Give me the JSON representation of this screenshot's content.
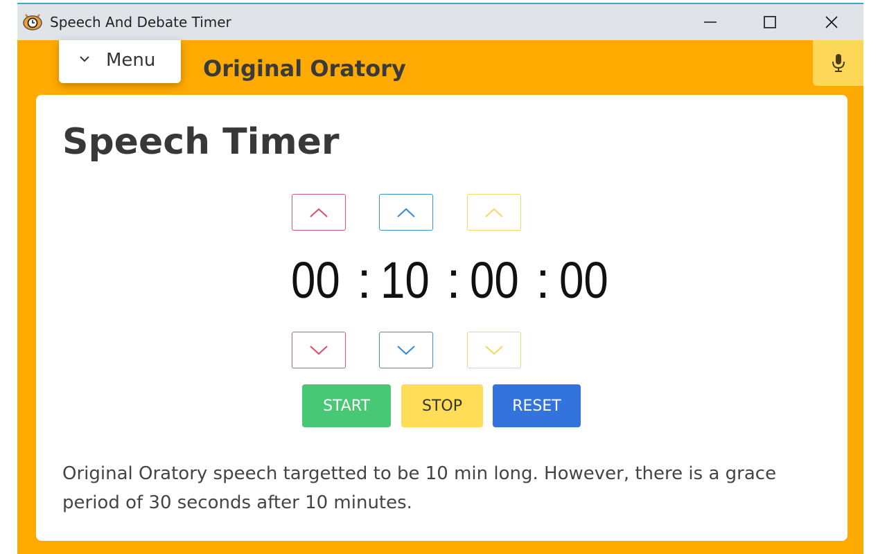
{
  "window": {
    "title": "Speech And Debate Timer",
    "icon": "timer-eye-app-icon",
    "controls": [
      "minimize-icon",
      "maximize-icon",
      "close-icon"
    ]
  },
  "header": {
    "menu_label": "Menu",
    "page_heading": "Original Oratory",
    "mic_icon": "microphone-icon"
  },
  "card": {
    "title": "Speech Timer",
    "time": {
      "hours": "00",
      "minutes": "10",
      "seconds": "00",
      "centiseconds": "00",
      "separator": ":"
    },
    "buttons": {
      "start": "START",
      "stop": "STOP",
      "reset": "RESET"
    },
    "description": "Original Oratory speech targetted to be 10 min long. However, there is a grace period of 30 seconds after 10 minutes."
  },
  "colors": {
    "background": "#ffaa00",
    "mic_button": "#fcd758",
    "hours_accent": "#d8566d",
    "minutes_accent": "#3a8fcf",
    "seconds_accent": "#f6d86a",
    "start": "#48c774",
    "stop": "#ffdd57",
    "reset": "#3273dc"
  }
}
